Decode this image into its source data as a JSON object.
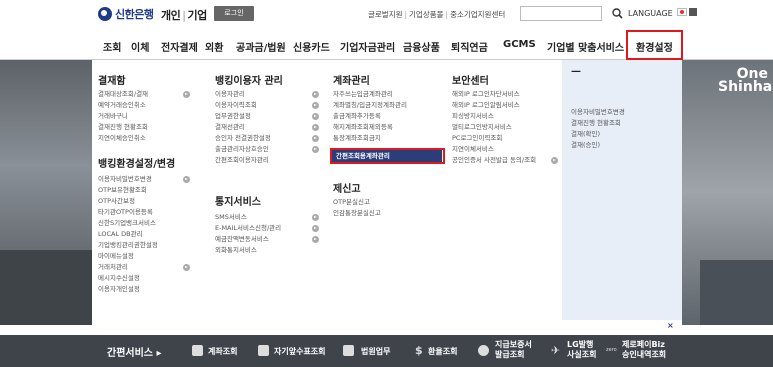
{
  "header": {
    "logo": "신한은행",
    "mode_personal": "개인",
    "mode_business": "기업",
    "login": "로그인",
    "utils": [
      "글로벌지원",
      "기업상품몰",
      "중소기업지원센터"
    ],
    "language": "LANGUAGE"
  },
  "gnb": [
    "조회",
    "이체",
    "전자결제",
    "외환",
    "공과금/법원",
    "신용카드",
    "기업자금관리",
    "금융상품",
    "퇴직연금",
    "GCMS",
    "기업별 맞춤서비스",
    "환경설정"
  ],
  "hero": {
    "brand_line1": "One",
    "brand_line2": "Shinhan"
  },
  "menu": {
    "col1": {
      "title1": "결재함",
      "items1": [
        "결재대상조회/결재",
        "예약거래승인취소",
        "거래바구니",
        "결재진행 현황조회",
        "지연이체승인취소"
      ],
      "title2": "뱅킹환경설정/변경",
      "items2": [
        "이용자비밀번호변경",
        "OTP보유현황조회",
        "OTP사간보정",
        "타기관OTP이용등록",
        "신한S기업뱅크서비스",
        "LOCAL DB관리",
        "기업뱅킹관리권한설정",
        "마이메뉴설정",
        "거래처관리",
        "메시지수신설정",
        "이용자개인설정"
      ]
    },
    "col2": {
      "title1": "뱅킹이용자 관리",
      "items1": [
        "이용자관리",
        "이용자이력조회",
        "업무권한설정",
        "결재선관리",
        "승인자 전결권한설정",
        "출금관리자상호승인",
        "간편조회이용자관리"
      ],
      "title2": "통지서비스",
      "items2": [
        "SMS서비스",
        "E-MAIL서비스신청/관리",
        "예금잔액변동서비스",
        "외화통지서비스"
      ]
    },
    "col3": {
      "title1": "계좌관리",
      "items1": [
        "자주쓰는입금계좌관리",
        "계좌별칭/입금지정계좌관리",
        "출금계좌추가등록",
        "해지계좌조회제외등록",
        "통장계좌조회금지",
        "간편조회용계좌관리"
      ],
      "title2": "제신고",
      "items2": [
        "OTP분실신고",
        "인감통장분실신고"
      ]
    },
    "col4": {
      "title1": "보안센터",
      "items1": [
        "해외IP 로그인차단서비스",
        "해외IP 로그인알림서비스",
        "피싱방지서비스",
        "멀티로그인방지서비스",
        "PC로그인이력조회",
        "지연이체서비스",
        "공인인증서 사전발급 동의/조회"
      ]
    },
    "col5": {
      "title1": "—",
      "items1": [
        "이용자비밀번호변경",
        "결재진행 현황조회",
        "결재(확인)",
        "결재(승인)"
      ]
    },
    "close": "×"
  },
  "quick": {
    "title": "간편서비스",
    "items": [
      {
        "label": "계좌조회"
      },
      {
        "label": "자기앞수표조회"
      },
      {
        "label": "법원업무"
      },
      {
        "label": "환율조회"
      },
      {
        "label1": "지급보증서",
        "label2": "발급조회"
      },
      {
        "label1": "LG발행",
        "label2": "사실조회"
      },
      {
        "label1": "제로페이Biz",
        "label2": "승인내역조회"
      }
    ]
  }
}
